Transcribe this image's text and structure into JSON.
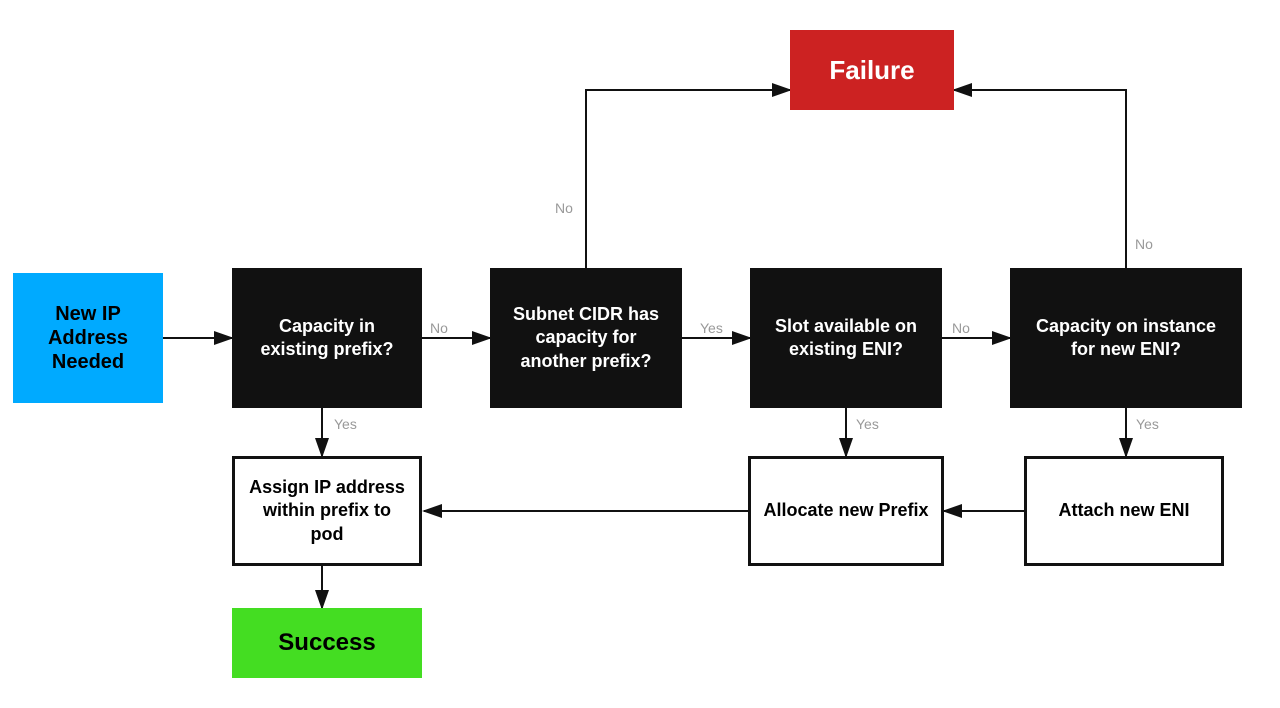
{
  "nodes": {
    "new_ip": {
      "label": "New IP Address Needed"
    },
    "capacity_existing": {
      "label": "Capacity in existing prefix?"
    },
    "subnet_cidr": {
      "label": "Subnet CIDR has capacity for another prefix?"
    },
    "slot_eni": {
      "label": "Slot available on existing ENI?"
    },
    "capacity_instance": {
      "label": "Capacity on instance for new ENI?"
    },
    "failure": {
      "label": "Failure"
    },
    "assign_ip": {
      "label": "Assign IP address within prefix to pod"
    },
    "allocate_prefix": {
      "label": "Allocate new Prefix"
    },
    "attach_eni": {
      "label": "Attach new ENI"
    },
    "success": {
      "label": "Success"
    }
  },
  "edge_labels": {
    "no1": "No",
    "no2": "No",
    "no3": "No",
    "no4": "No",
    "yes1": "Yes",
    "yes2": "Yes",
    "yes3": "Yes"
  }
}
